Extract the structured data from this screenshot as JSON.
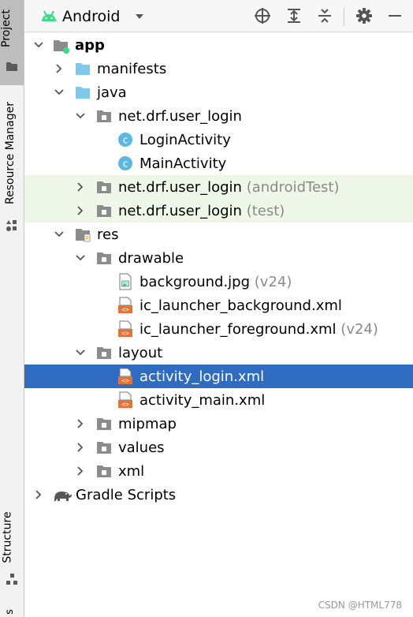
{
  "side_tabs": {
    "project": "Project",
    "resource_manager": "Resource Manager",
    "structure": "Structure",
    "bottom_partial": "s"
  },
  "toolbar": {
    "view_mode": "Android",
    "icons": [
      "locate-icon",
      "expand-all-icon",
      "collapse-all-icon",
      "settings-icon",
      "minimize-icon"
    ]
  },
  "tree": {
    "app": "app",
    "manifests": "manifests",
    "java": "java",
    "pkg_main": "net.drf.user_login",
    "login_activity": "LoginActivity",
    "main_activity": "MainActivity",
    "pkg_android_test": "net.drf.user_login",
    "pkg_android_test_suffix": "(androidTest)",
    "pkg_test": "net.drf.user_login",
    "pkg_test_suffix": "(test)",
    "res": "res",
    "drawable": "drawable",
    "background": "background.jpg",
    "background_suffix": "(v24)",
    "ic_bg": "ic_launcher_background.xml",
    "ic_fg": "ic_launcher_foreground.xml",
    "ic_fg_suffix": "(v24)",
    "layout": "layout",
    "activity_login": "activity_login.xml",
    "activity_main": "activity_main.xml",
    "mipmap": "mipmap",
    "values": "values",
    "xml": "xml",
    "gradle": "Gradle Scripts"
  },
  "watermark": "CSDN @HTML778",
  "colors": {
    "selection": "#2f6bc0",
    "test_row_bg": "#eef7e8",
    "folder_blue": "#7ec8ea",
    "folder_gray": "#8c8c8c",
    "class_icon": "#5cb8e0",
    "xml_icon": "#e3733b",
    "android_green": "#3ddc84"
  }
}
